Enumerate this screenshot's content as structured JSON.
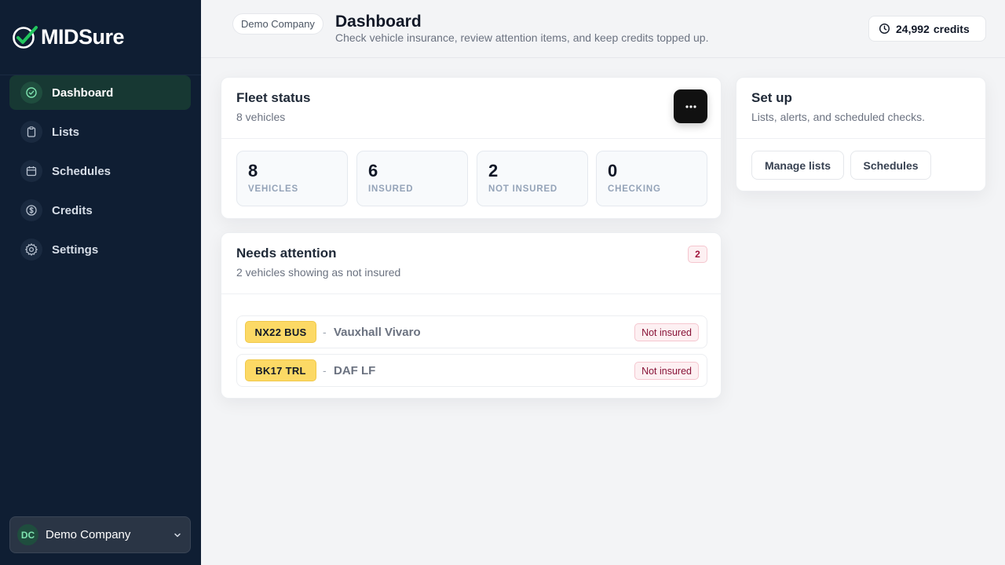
{
  "app": {
    "brand": "MIDSure"
  },
  "colors": {
    "sidebar_bg": "#0f1e33",
    "accent_green": "#22c55e",
    "plate_yellow": "#fcd965",
    "danger": "#9f1239"
  },
  "sidebar": {
    "items": [
      {
        "label": "Dashboard",
        "icon": "check-circle-icon",
        "active": true
      },
      {
        "label": "Lists",
        "icon": "clipboard-icon",
        "active": false
      },
      {
        "label": "Schedules",
        "icon": "calendar-icon",
        "active": false
      },
      {
        "label": "Credits",
        "icon": "dollar-circle-icon",
        "active": false
      },
      {
        "label": "Settings",
        "icon": "gear-icon",
        "active": false
      }
    ],
    "company": {
      "initials": "DC",
      "name": "Demo Company"
    }
  },
  "header": {
    "company_pill": "Demo Company",
    "title": "Dashboard",
    "subtitle": "Check vehicle insurance, review attention items, and keep credits topped up.",
    "credits_value": "24,992",
    "credits_label": "credits"
  },
  "fleet": {
    "title": "Fleet status",
    "subtitle": "8 vehicles",
    "stats": [
      {
        "value": "8",
        "label": "VEHICLES"
      },
      {
        "value": "6",
        "label": "INSURED"
      },
      {
        "value": "2",
        "label": "NOT INSURED"
      },
      {
        "value": "0",
        "label": "CHECKING"
      }
    ]
  },
  "setup": {
    "title": "Set up",
    "subtitle": "Lists, alerts, and scheduled checks.",
    "manage_lists": "Manage lists",
    "schedules": "Schedules"
  },
  "attention": {
    "title": "Needs attention",
    "subtitle": "2 vehicles showing as not insured",
    "count": "2",
    "vehicles": [
      {
        "plate": "NX22 BUS",
        "separator": "-",
        "model": "Vauxhall Vivaro",
        "status": "Not insured"
      },
      {
        "plate": "BK17 TRL",
        "separator": "-",
        "model": "DAF LF",
        "status": "Not insured"
      }
    ]
  }
}
